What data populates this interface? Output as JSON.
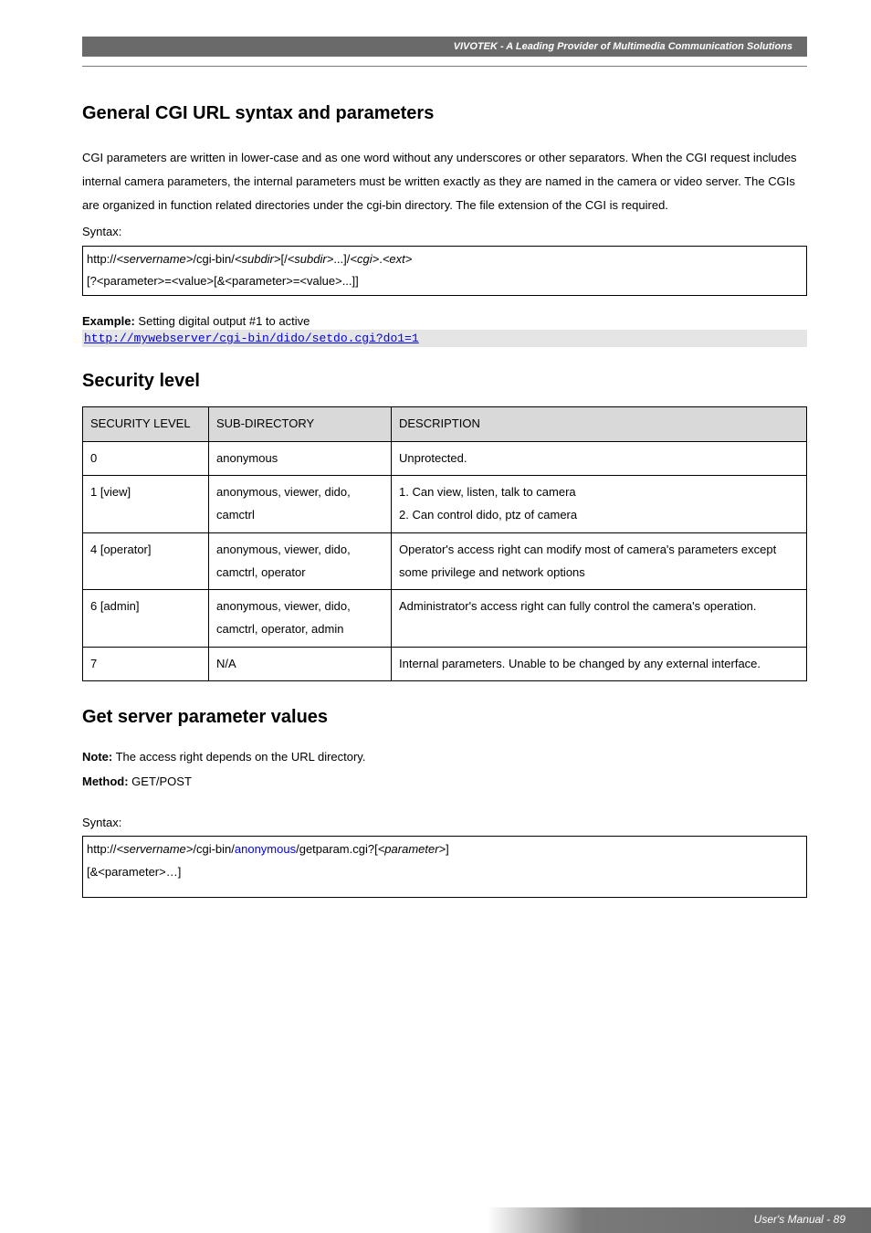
{
  "header": {
    "brand_line": "VIVOTEK - A Leading Provider of Multimedia Communication Solutions"
  },
  "section1": {
    "title": "General CGI URL syntax and parameters",
    "para": "CGI parameters are written in lower-case and as one word without any underscores or other separators. When the CGI request includes internal camera parameters, the internal parameters must be written exactly as they are named in the camera or video server. The CGIs are organized in function related directories under the cgi-bin directory. The file extension of the CGI is required.",
    "syntax_label": "Syntax:",
    "syntax_line1": "http://<servername>/cgi-bin/<subdir>[/<subdir>...]/<cgi>.<ext>",
    "syntax_line2": "[?<parameter>=<value>[&<parameter>=<value>...]]",
    "example_prefix": "Example:",
    "example_text": " Setting digital output #1 to active",
    "example_link": "http://mywebserver/cgi-bin/dido/setdo.cgi?do1=1"
  },
  "section2": {
    "title": "Security level",
    "headers": {
      "c1": "SECURITY LEVEL",
      "c2": "SUB-DIRECTORY",
      "c3": "DESCRIPTION"
    },
    "rows": [
      {
        "level": "0",
        "sub": "anonymous",
        "desc": "Unprotected."
      },
      {
        "level": "1 [view]",
        "sub": "anonymous, viewer, dido, camctrl",
        "desc_l1": "1. Can view, listen, talk to camera",
        "desc_l2": "2. Can control dido, ptz of camera"
      },
      {
        "level": "4 [operator]",
        "sub": "anonymous, viewer, dido, camctrl, operator",
        "desc": "Operator's access right can modify most of camera's parameters except some privilege and network options"
      },
      {
        "level": "6 [admin]",
        "sub": "anonymous, viewer, dido, camctrl, operator, admin",
        "desc": "Administrator's access right can fully control the camera's operation."
      },
      {
        "level": "7",
        "sub": "N/A",
        "desc": "Internal parameters. Unable to be changed by any external interface."
      }
    ]
  },
  "section3": {
    "title": "Get server parameter values",
    "note_prefix": "Note:",
    "note_text": " The access right depends on the URL directory.",
    "method_prefix": "Method:",
    "method_text": " GET/POST",
    "syntax_label": "Syntax:",
    "syntax_line1_a": "http://<servername>/cgi-bin/",
    "syntax_line1_b": "anonymous",
    "syntax_line1_c": "/getparam.cgi?[<parameter>]",
    "syntax_line2": "[&<parameter>…]"
  },
  "footer": {
    "text": "User's Manual - 89"
  }
}
